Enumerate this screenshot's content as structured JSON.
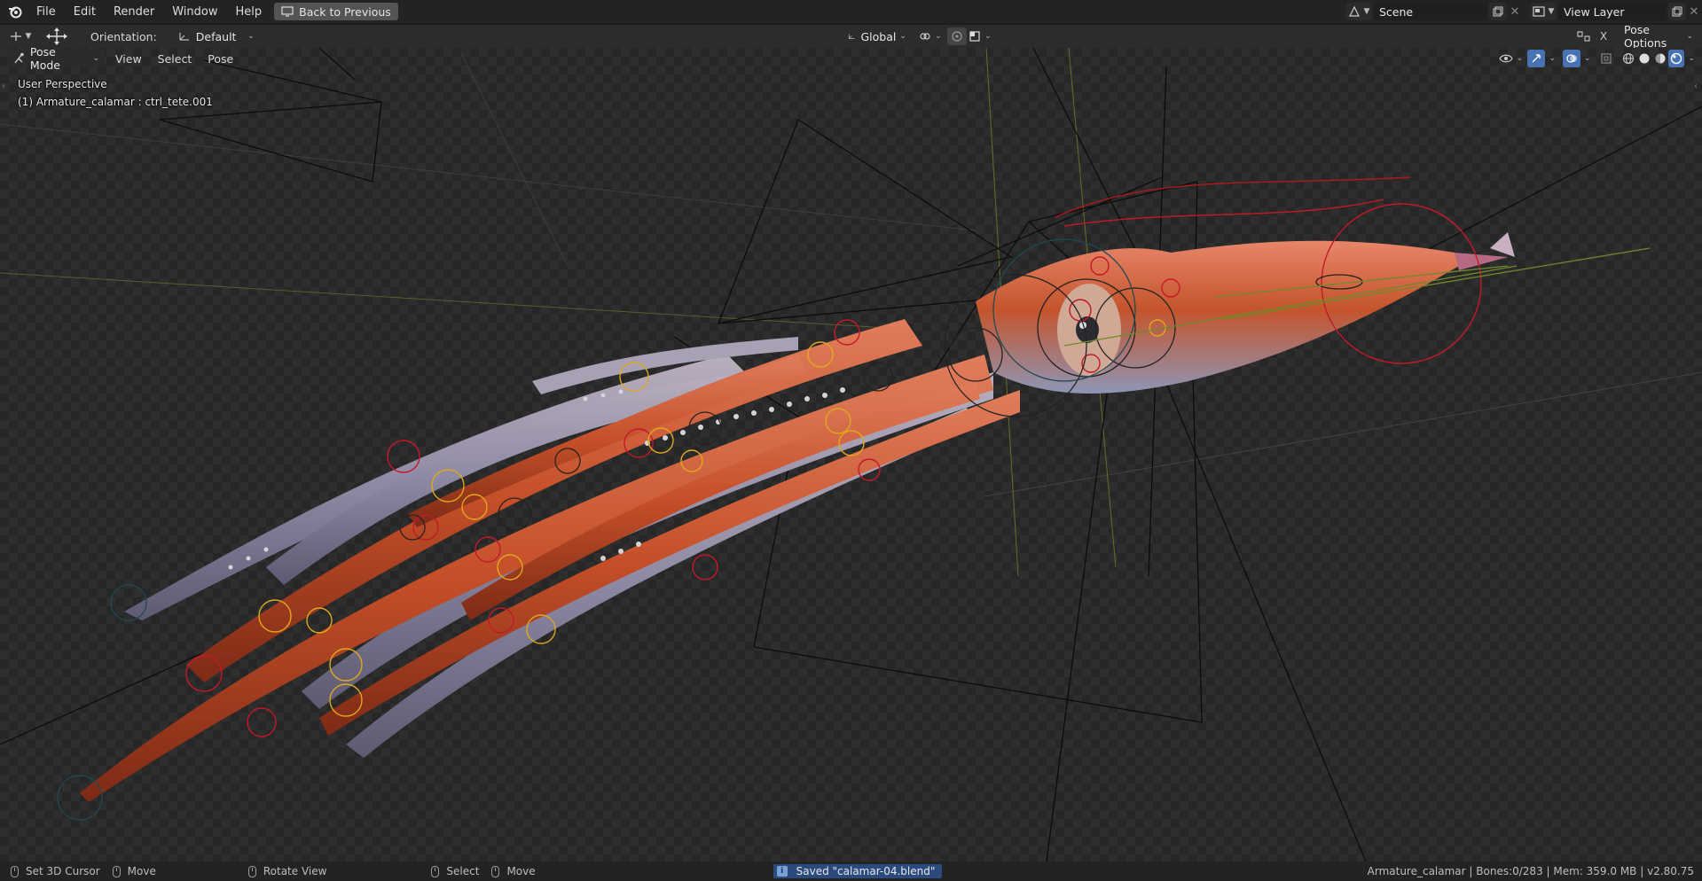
{
  "menu": {
    "items": [
      "File",
      "Edit",
      "Render",
      "Window",
      "Help"
    ],
    "back_button": "Back to Previous",
    "scene_label": "Scene",
    "view_layer_label": "View Layer"
  },
  "tool_header": {
    "orientation_label": "Orientation:",
    "orientation_value": "Default",
    "transform_space": "Global",
    "pose_options": "Pose Options",
    "x_mirror": "X"
  },
  "viewport_header": {
    "mode": "Pose Mode",
    "menus": [
      "View",
      "Select",
      "Pose"
    ]
  },
  "viewport": {
    "perspective": "User Perspective",
    "active_object": "(1) Armature_calamar : ctrl_tete.001"
  },
  "statusbar": {
    "set_cursor": "Set 3D Cursor",
    "move": "Move",
    "rotate": "Rotate View",
    "select": "Select",
    "move2": "Move",
    "saved_message": "Saved \"calamar-04.blend\"",
    "stats": "Armature_calamar | Bones:0/283 | Mem: 359.0 MB | v2.80.75"
  },
  "colors": {
    "accent_blue": "#4772b3",
    "squid_body": "#c4542c",
    "bone_red": "#c4182a",
    "bone_yellow": "#e0a81c"
  }
}
